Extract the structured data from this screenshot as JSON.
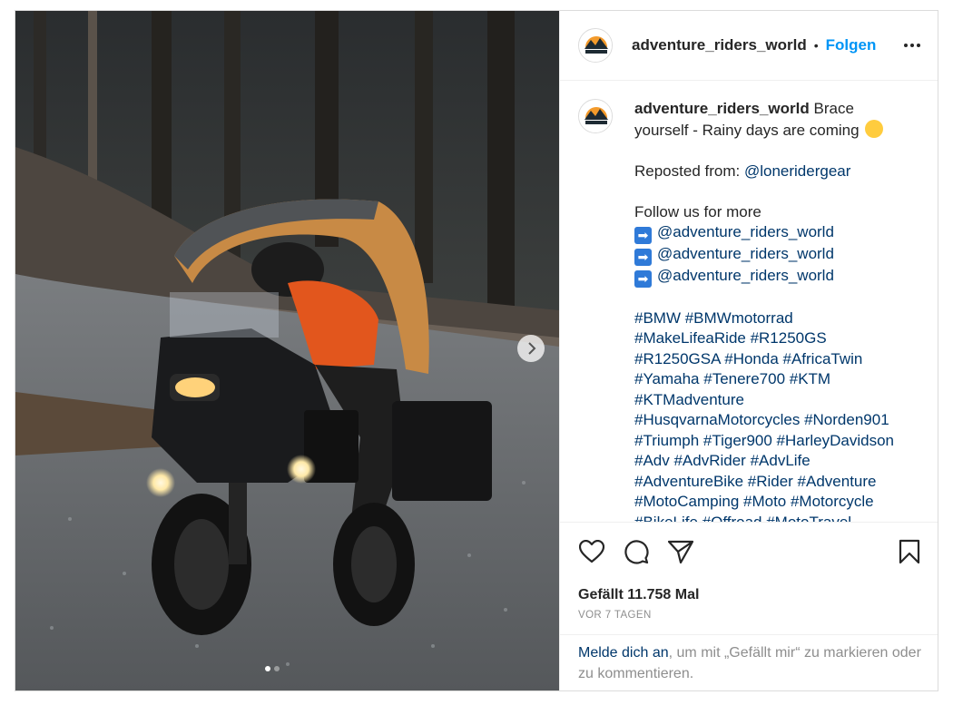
{
  "post": {
    "username": "adventure_riders_world",
    "separator": "•",
    "follow_label": "Folgen",
    "caption": {
      "username": "adventure_riders_world",
      "text_line1": "Brace yourself - Rainy days are coming",
      "repost_prefix": "Reposted from: ",
      "repost_handle": "@loneridergear",
      "follow_more": "Follow us for more",
      "arrow_symbol": "➡",
      "mentions": [
        "@adventure_riders_world",
        "@adventure_riders_world",
        "@adventure_riders_world"
      ],
      "hashtags": "#BMW #BMWmotorrad #MakeLifeaRide #R1250GS #R1250GSA #Honda #AfricaTwin #Yamaha #Tenere700 #KTM #KTMadventure #HusqvarnaMotorcycles #Norden901 #Triumph #Tiger900 #HarleyDavidson #Adv #AdvRider #AdvLife #AdventureBike #Rider #Adventure #MotoCamping #Moto #Motorcycle #BikeLife #Offroad #MotoTravel"
    },
    "likes_text": "Gefällt 11.758 Mal",
    "time_text": "VOR 7 TAGEN",
    "login_link": "Melde dich an",
    "login_rest": ", um mit „Gefällt mir“ zu markieren oder zu kommentieren.",
    "carousel": {
      "total": 2,
      "active": 1
    }
  },
  "icons": {
    "like": "heart-icon",
    "comment": "comment-icon",
    "share": "paper-plane-icon",
    "save": "bookmark-icon",
    "next": "chevron-right-icon",
    "more": "more-dots-icon"
  },
  "colors": {
    "accent": "#0095f6",
    "link": "#00376b",
    "muted": "#8e8e8e",
    "text": "#262626",
    "border": "#dbdbdb"
  }
}
